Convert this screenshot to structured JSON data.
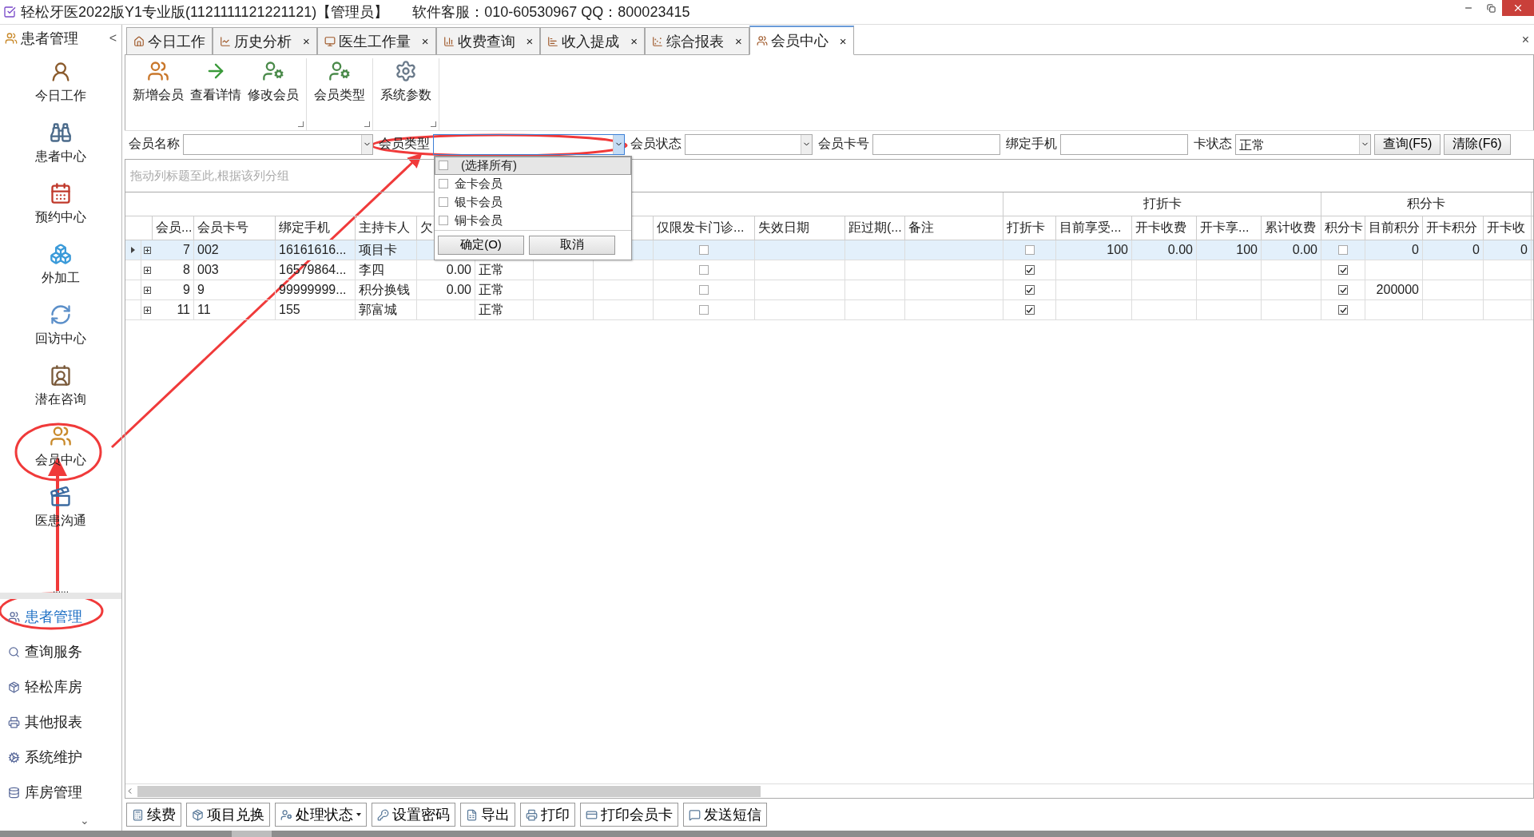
{
  "window": {
    "title": "轻松牙医2022版Y1专业版(1121111121221121)【管理员】",
    "support": "软件客服：010-60530967 QQ：800023415"
  },
  "sidebar": {
    "header": "患者管理",
    "collapse": "<",
    "items": [
      {
        "label": "今日工作",
        "selected": false
      },
      {
        "label": "患者中心",
        "selected": false
      },
      {
        "label": "预约中心",
        "selected": false
      },
      {
        "label": "外加工",
        "selected": false
      },
      {
        "label": "回访中心",
        "selected": false
      },
      {
        "label": "潜在咨询",
        "selected": false
      },
      {
        "label": "会员中心",
        "selected": false
      },
      {
        "label": "医患沟通",
        "selected": false
      }
    ],
    "splitter": "......",
    "groups": [
      {
        "label": "患者管理",
        "selected": true
      },
      {
        "label": "查询服务",
        "selected": false
      },
      {
        "label": "轻松库房",
        "selected": false
      },
      {
        "label": "其他报表",
        "selected": false
      },
      {
        "label": "系统维护",
        "selected": false
      },
      {
        "label": "库房管理",
        "selected": false
      }
    ],
    "more": "⌄"
  },
  "tabs": [
    {
      "label": "今日工作",
      "selected": false,
      "closable": false
    },
    {
      "label": "历史分析",
      "selected": false,
      "closable": true
    },
    {
      "label": "医生工作量",
      "selected": false,
      "closable": true
    },
    {
      "label": "收费查询",
      "selected": false,
      "closable": true
    },
    {
      "label": "收入提成",
      "selected": false,
      "closable": true
    },
    {
      "label": "综合报表",
      "selected": false,
      "closable": true
    },
    {
      "label": "会员中心",
      "selected": true,
      "closable": true
    }
  ],
  "tab_close": "×",
  "ribbon": {
    "groups": [
      [
        "新增会员",
        "查看详情",
        "修改会员"
      ],
      [
        "会员类型"
      ],
      [
        "系统参数"
      ]
    ]
  },
  "filters": [
    {
      "kind": "combo",
      "label": "会员名称",
      "open": false
    },
    {
      "kind": "combo",
      "label": "会员类型",
      "open": true
    },
    {
      "kind": "combo",
      "label": "会员状态",
      "open": false
    },
    {
      "kind": "input",
      "label": "会员卡号"
    },
    {
      "kind": "input",
      "label": "绑定手机"
    },
    {
      "kind": "combo",
      "label": "卡状态",
      "value": "正常",
      "open": false
    }
  ],
  "filter_buttons": [
    "查询(F5)",
    "清除(F6)"
  ],
  "type_dropdown": {
    "items": [
      {
        "label": "(选择所有)",
        "checked": false,
        "selected": true
      },
      {
        "label": "金卡会员",
        "checked": false,
        "selected": false
      },
      {
        "label": "银卡会员",
        "checked": false,
        "selected": false
      },
      {
        "label": "铜卡会员",
        "checked": false,
        "selected": false
      }
    ],
    "buttons": [
      "确定(O)",
      "取消"
    ]
  },
  "group_panel": {
    "placeholder": "拖动列标题至此,根据该列分组"
  },
  "table": {
    "column_groups": [
      {
        "label": "打折卡"
      },
      {
        "label": "积分卡"
      }
    ],
    "columns": [
      {
        "label": "会员...",
        "kind": "number"
      },
      {
        "label": "会员卡号",
        "kind": "text"
      },
      {
        "label": "绑定手机",
        "kind": "text"
      },
      {
        "label": "主持卡人",
        "kind": "text"
      },
      {
        "label": "欠",
        "kind": "number"
      },
      {
        "kind": "text"
      },
      {
        "kind": "text"
      },
      {
        "kind": "text"
      },
      {
        "label": "仅限发卡门诊...",
        "kind": "check"
      },
      {
        "label": "失效日期",
        "kind": "text"
      },
      {
        "label": "距过期(...",
        "kind": "text"
      },
      {
        "label": "备注",
        "kind": "text"
      },
      {
        "label": "打折卡",
        "kind": "check"
      },
      {
        "label": "目前享受...",
        "kind": "number"
      },
      {
        "label": "开卡收费",
        "kind": "number"
      },
      {
        "label": "开卡享...",
        "kind": "number"
      },
      {
        "label": "累计收费",
        "kind": "number"
      },
      {
        "label": "积分卡",
        "kind": "check"
      },
      {
        "label": "目前积分",
        "kind": "number"
      },
      {
        "label": "开卡积分",
        "kind": "number"
      },
      {
        "label": "开卡收",
        "kind": "number"
      }
    ],
    "rows": [
      {
        "selected": true,
        "cells": [
          "7",
          "002",
          "16161616...",
          "项目卡",
          null,
          null,
          null,
          null,
          false,
          null,
          null,
          null,
          false,
          "100",
          "0.00",
          "100",
          "0.00",
          false,
          "0",
          "0",
          "0"
        ]
      },
      {
        "selected": false,
        "cells": [
          "8",
          "003",
          "16579864...",
          "李四",
          "0.00",
          "正常",
          null,
          null,
          false,
          null,
          null,
          null,
          true,
          null,
          null,
          null,
          null,
          true,
          null,
          null,
          null
        ]
      },
      {
        "selected": false,
        "cells": [
          "9",
          "9",
          "99999999...",
          "积分换钱",
          "0.00",
          "正常",
          null,
          null,
          false,
          null,
          null,
          null,
          true,
          null,
          null,
          null,
          null,
          true,
          "200000",
          null,
          null
        ]
      },
      {
        "selected": false,
        "cells": [
          "11",
          "11",
          "155",
          "郭富城",
          null,
          "正常",
          null,
          null,
          false,
          null,
          null,
          null,
          true,
          null,
          null,
          null,
          null,
          true,
          null,
          null,
          null
        ]
      }
    ]
  },
  "bottom_toolbar": [
    {
      "label": "续费",
      "has_menu": false
    },
    {
      "label": "项目兑换",
      "has_menu": false
    },
    {
      "label": "处理状态",
      "has_menu": true
    },
    {
      "label": "设置密码",
      "has_menu": false
    },
    {
      "label": "导出",
      "has_menu": false
    },
    {
      "label": "打印",
      "has_menu": false
    },
    {
      "label": "打印会员卡",
      "has_menu": false
    },
    {
      "label": "发送短信",
      "has_menu": false
    }
  ]
}
